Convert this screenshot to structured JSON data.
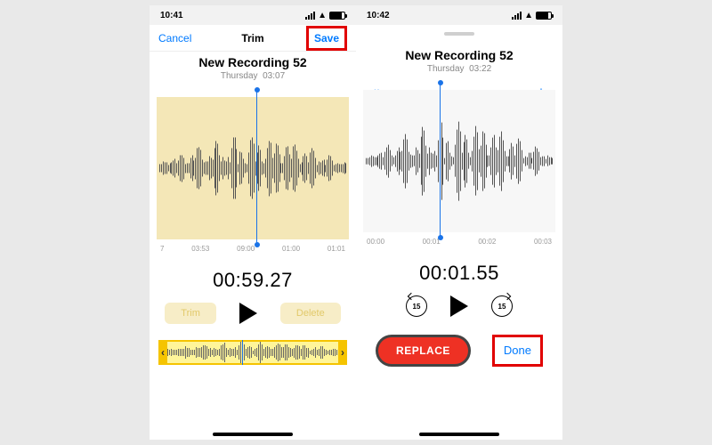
{
  "left": {
    "status_time": "10:41",
    "nav": {
      "cancel": "Cancel",
      "title": "Trim",
      "save": "Save"
    },
    "recording_title": "New Recording 52",
    "recording_sub_day": "Thursday",
    "recording_sub_dur": "03:07",
    "axis": [
      "7",
      "03:53",
      "09:00",
      "01:00",
      "01:01"
    ],
    "bigtime": "00:59.27",
    "trim_label": "Trim",
    "delete_label": "Delete"
  },
  "right": {
    "status_time": "10:42",
    "recording_title": "New Recording 52",
    "recording_sub_day": "Thursday",
    "recording_sub_dur": "03:22",
    "axis": [
      "00:00",
      "00:01",
      "00:02",
      "00:03"
    ],
    "bigtime": "00:01.55",
    "skip_seconds": "15",
    "replace": "REPLACE",
    "done": "Done"
  }
}
